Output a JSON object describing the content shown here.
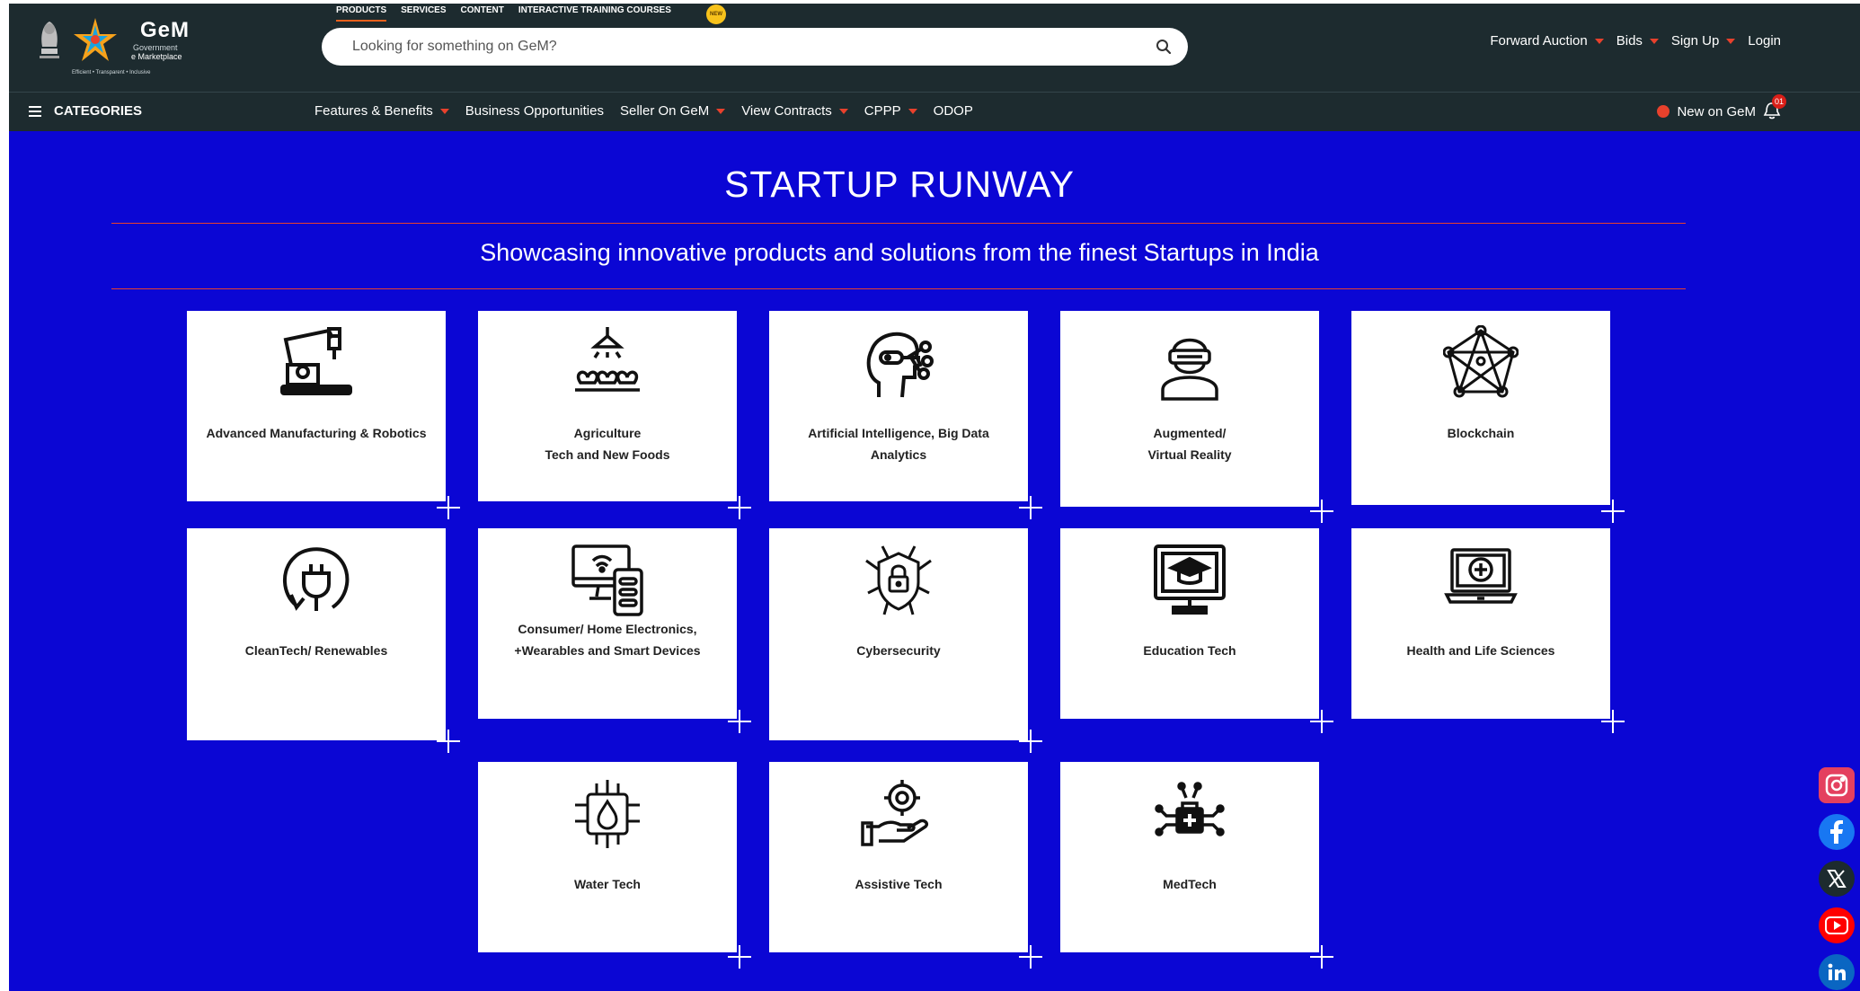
{
  "header": {
    "logo": {
      "title": "GeM",
      "subtitle_1": "Government",
      "subtitle_2": "e Marketplace",
      "tagline": "Efficient • Transparent • Inclusive"
    },
    "tabs": [
      {
        "label": "PRODUCTS"
      },
      {
        "label": "SERVICES"
      },
      {
        "label": "CONTENT"
      },
      {
        "label": "INTERACTIVE TRAINING COURSES"
      }
    ],
    "new_badge": "NEW",
    "search": {
      "placeholder": "Looking for something on GeM?"
    },
    "right_nav": [
      {
        "label": "Forward Auction"
      },
      {
        "label": "Bids"
      },
      {
        "label": "Sign Up"
      },
      {
        "label": "Login"
      }
    ]
  },
  "menubar": {
    "categories_label": "CATEGORIES",
    "items": [
      {
        "label": "Features & Benefits"
      },
      {
        "label": "Business Opportunities"
      },
      {
        "label": "Seller On GeM"
      },
      {
        "label": "View Contracts"
      },
      {
        "label": "CPPP"
      },
      {
        "label": "ODOP"
      }
    ],
    "new_on_gem": "New on GeM",
    "notification_count": "01"
  },
  "page": {
    "title": "STARTUP RUNWAY",
    "subtitle": "Showcasing innovative products and solutions from the finest Startups in India"
  },
  "cards": [
    {
      "label": "Advanced Manufacturing & Robotics",
      "icon": "robot-arm-icon"
    },
    {
      "label": "Agriculture\nTech and New Foods",
      "icon": "plant-light-icon"
    },
    {
      "label": "Artificial Intelligence, Big Data\nAnalytics",
      "icon": "ai-head-icon"
    },
    {
      "label": "Augmented/\nVirtual Reality",
      "icon": "vr-headset-icon"
    },
    {
      "label": "Blockchain",
      "icon": "blockchain-icon"
    },
    {
      "label": "CleanTech/ Renewables",
      "icon": "plug-icon"
    },
    {
      "label": "Consumer/ Home Electronics,\n+Wearables and Smart Devices",
      "icon": "smart-devices-icon"
    },
    {
      "label": "Cybersecurity",
      "icon": "shield-lock-icon"
    },
    {
      "label": "Education Tech",
      "icon": "monitor-graduation-icon"
    },
    {
      "label": "Health and Life Sciences",
      "icon": "laptop-health-icon"
    },
    {
      "label": "Water Tech",
      "icon": "water-chip-icon"
    },
    {
      "label": "Assistive Tech",
      "icon": "hand-gear-icon"
    },
    {
      "label": "MedTech",
      "icon": "medical-kit-icon"
    }
  ],
  "social": [
    {
      "name": "instagram-icon",
      "color": "#e4405f"
    },
    {
      "name": "facebook-icon",
      "color": "#1877f2"
    },
    {
      "name": "x-icon",
      "color": "#1d2b2f"
    },
    {
      "name": "youtube-icon",
      "color": "#ff0000"
    },
    {
      "name": "linkedin-icon",
      "color": "#0a66c2"
    }
  ],
  "colors": {
    "header_bg": "#1d2b2f",
    "main_bg": "#0b06d4",
    "accent": "#e8412c"
  }
}
